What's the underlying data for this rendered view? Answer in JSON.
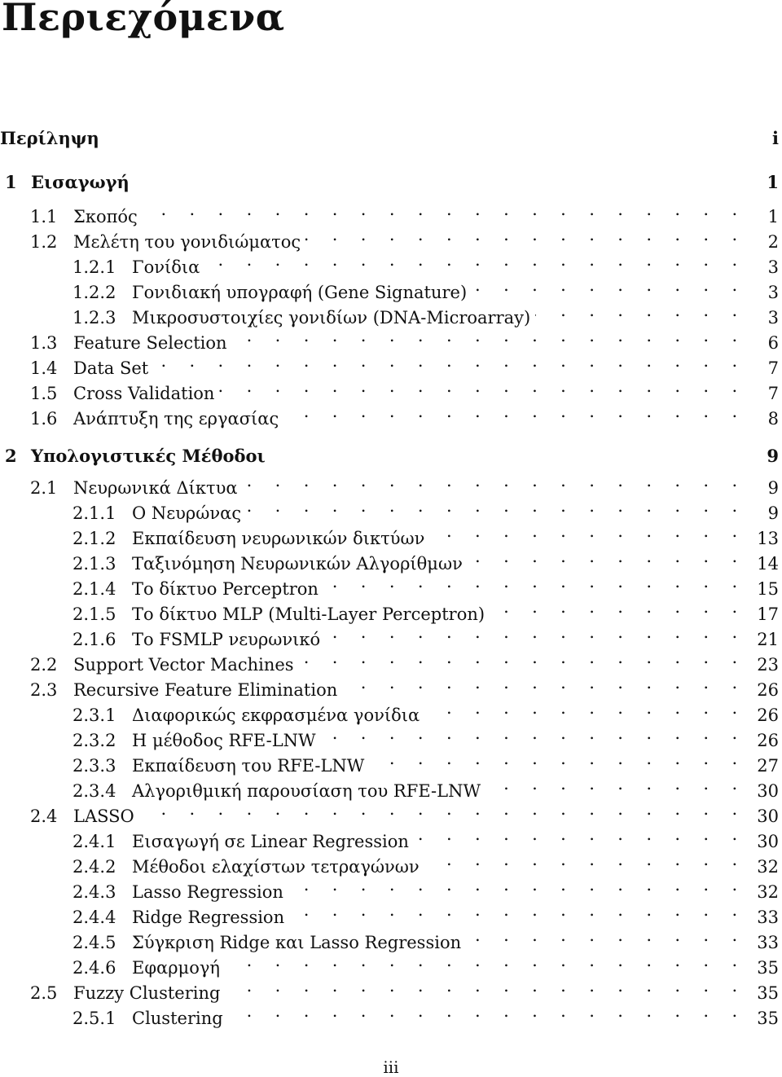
{
  "heading": "Περιεχόμενα",
  "entries": [
    {
      "level": 0,
      "num": "",
      "title": "Περίληψη",
      "page": "i",
      "bold": true
    },
    {
      "level": 1,
      "num": "1",
      "title": "Εισαγωγή",
      "page": "1",
      "bold": true
    },
    {
      "level": 2,
      "num": "1.1",
      "title": "Σκοπός",
      "page": "1"
    },
    {
      "level": 2,
      "num": "1.2",
      "title": "Μελέτη του γονιδιώματος",
      "page": "2"
    },
    {
      "level": 3,
      "num": "1.2.1",
      "title": "Γονίδια",
      "page": "3"
    },
    {
      "level": 3,
      "num": "1.2.2",
      "title": "Γονιδιακή υπογραφή (Gene Signature)",
      "page": "3"
    },
    {
      "level": 3,
      "num": "1.2.3",
      "title": "Μικροσυστοιχίες γονιδίων (DNA-Microarray)",
      "page": "3"
    },
    {
      "level": 2,
      "num": "1.3",
      "title": "Feature Selection",
      "page": "6"
    },
    {
      "level": 2,
      "num": "1.4",
      "title": "Data Set",
      "page": "7"
    },
    {
      "level": 2,
      "num": "1.5",
      "title": "Cross Validation",
      "page": "7"
    },
    {
      "level": 2,
      "num": "1.6",
      "title": "Ανάπτυξη της εργασίας",
      "page": "8"
    },
    {
      "level": 1,
      "num": "2",
      "title": "Υπολογιστικές Μέθοδοι",
      "page": "9",
      "bold": true
    },
    {
      "level": 2,
      "num": "2.1",
      "title": "Νευρωνικά Δίκτυα",
      "page": "9"
    },
    {
      "level": 3,
      "num": "2.1.1",
      "title": "Ο Νευρώνας",
      "page": "9"
    },
    {
      "level": 3,
      "num": "2.1.2",
      "title": "Εκπαίδευση νευρωνικών δικτύων",
      "page": "13"
    },
    {
      "level": 3,
      "num": "2.1.3",
      "title": "Ταξινόμηση Νευρωνικών Αλγορίθμων",
      "page": "14"
    },
    {
      "level": 3,
      "num": "2.1.4",
      "title": "Το δίκτυο Perceptron",
      "page": "15"
    },
    {
      "level": 3,
      "num": "2.1.5",
      "title": "Το δίκτυο MLP (Multi-Layer Perceptron)",
      "page": "17"
    },
    {
      "level": 3,
      "num": "2.1.6",
      "title": "Το FSMLP νευρωνικό",
      "page": "21"
    },
    {
      "level": 2,
      "num": "2.2",
      "title": "Support Vector Machines",
      "page": "23"
    },
    {
      "level": 2,
      "num": "2.3",
      "title": "Recursive Feature Elimination",
      "page": "26"
    },
    {
      "level": 3,
      "num": "2.3.1",
      "title": "Διαφορικώς εκφρασμένα γονίδια",
      "page": "26"
    },
    {
      "level": 3,
      "num": "2.3.2",
      "title": "Η μέθοδος RFE-LNW",
      "page": "26"
    },
    {
      "level": 3,
      "num": "2.3.3",
      "title": "Εκπαίδευση του RFE-LNW",
      "page": "27"
    },
    {
      "level": 3,
      "num": "2.3.4",
      "title": "Αλγοριθμική παρουσίαση του RFE-LNW",
      "page": "30"
    },
    {
      "level": 2,
      "num": "2.4",
      "title": "LASSO",
      "page": "30"
    },
    {
      "level": 3,
      "num": "2.4.1",
      "title": "Εισαγωγή σε Linear Regression",
      "page": "30"
    },
    {
      "level": 3,
      "num": "2.4.2",
      "title": "Μέθοδοι ελαχίστων τετραγώνων",
      "page": "32"
    },
    {
      "level": 3,
      "num": "2.4.3",
      "title": "Lasso Regression",
      "page": "32"
    },
    {
      "level": 3,
      "num": "2.4.4",
      "title": "Ridge Regression",
      "page": "33"
    },
    {
      "level": 3,
      "num": "2.4.5",
      "title": "Σύγκριση Ridge και Lasso Regression",
      "page": "33"
    },
    {
      "level": 3,
      "num": "2.4.6",
      "title": "Εφαρμογή",
      "page": "35"
    },
    {
      "level": 2,
      "num": "2.5",
      "title": "Fuzzy Clustering",
      "page": "35"
    },
    {
      "level": 3,
      "num": "2.5.1",
      "title": "Clustering",
      "page": "35"
    }
  ],
  "footer_page": "iii"
}
